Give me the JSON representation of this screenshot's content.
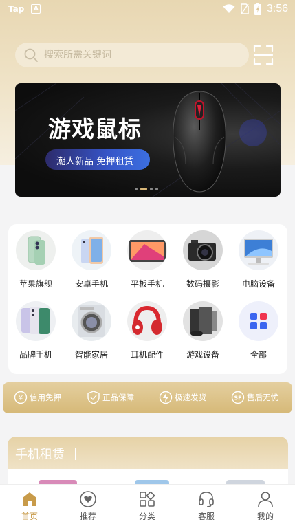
{
  "status_bar": {
    "carrier": "Tap",
    "time": "3:56"
  },
  "search": {
    "placeholder": "搜索所需关键词"
  },
  "banner": {
    "title": "游戏鼠标",
    "subtitle": "潮人新品 免押租赁",
    "page_count": 4,
    "active_page": 2
  },
  "categories": [
    {
      "label": "苹果旗舰",
      "icon": "iphone-green-icon"
    },
    {
      "label": "安卓手机",
      "icon": "android-phone-icon"
    },
    {
      "label": "平板手机",
      "icon": "tablet-icon"
    },
    {
      "label": "数码摄影",
      "icon": "camera-icon"
    },
    {
      "label": "电脑设备",
      "icon": "computer-icon"
    },
    {
      "label": "品牌手机",
      "icon": "brand-phones-icon"
    },
    {
      "label": "智能家居",
      "icon": "washing-machine-icon"
    },
    {
      "label": "耳机配件",
      "icon": "headphones-icon"
    },
    {
      "label": "游戏设备",
      "icon": "game-console-icon"
    },
    {
      "label": "全部",
      "icon": "grid-all-icon"
    }
  ],
  "guarantees": [
    {
      "label": "信用免押",
      "icon": "credit-icon"
    },
    {
      "label": "正品保障",
      "icon": "shield-icon"
    },
    {
      "label": "极速发货",
      "icon": "lightning-icon"
    },
    {
      "label": "售后无忧",
      "icon": "sf-icon"
    }
  ],
  "section": {
    "title": "手机租赁"
  },
  "tabs": [
    {
      "label": "首页",
      "icon": "home-icon",
      "active": true
    },
    {
      "label": "推荐",
      "icon": "heart-icon",
      "active": false
    },
    {
      "label": "分类",
      "icon": "category-icon",
      "active": false
    },
    {
      "label": "客服",
      "icon": "headset-icon",
      "active": false
    },
    {
      "label": "我的",
      "icon": "user-icon",
      "active": false
    }
  ],
  "colors": {
    "accent": "#c89b4a",
    "gold": "#d6b978"
  }
}
